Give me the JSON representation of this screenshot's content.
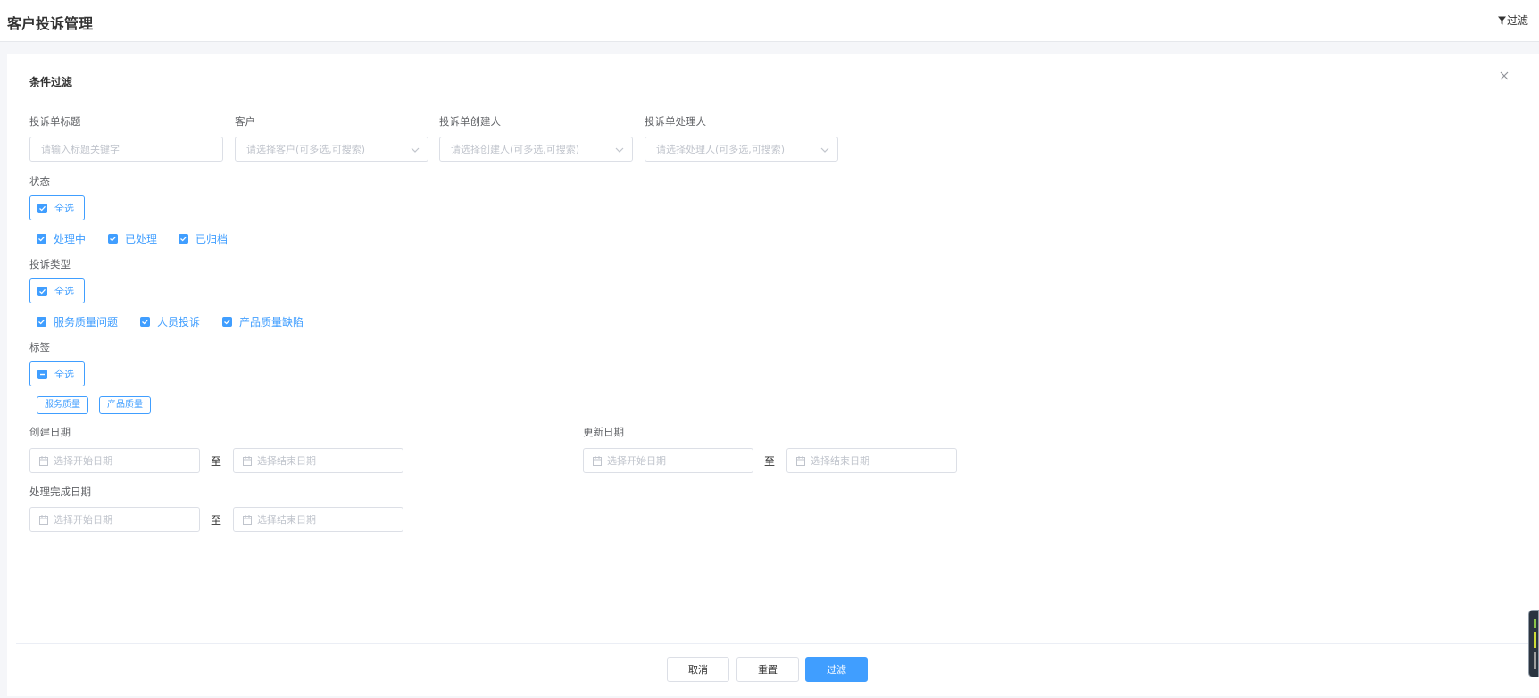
{
  "header": {
    "title": "客户投诉管理",
    "filter_label": "过滤"
  },
  "panel": {
    "title": "条件过滤"
  },
  "fields": {
    "complaint_title": {
      "label": "投诉单标题",
      "placeholder": "请输入标题关键字"
    },
    "customer": {
      "label": "客户",
      "placeholder": "请选择客户(可多选,可搜索)"
    },
    "creator": {
      "label": "投诉单创建人",
      "placeholder": "请选择创建人(可多选,可搜索)"
    },
    "handler": {
      "label": "投诉单处理人",
      "placeholder": "请选择处理人(可多选,可搜索)"
    }
  },
  "status": {
    "label": "状态",
    "select_all": "全选",
    "options": [
      "处理中",
      "已处理",
      "已归档"
    ]
  },
  "complaint_type": {
    "label": "投诉类型",
    "select_all": "全选",
    "options": [
      "服务质量问题",
      "人员投诉",
      "产品质量缺陷"
    ]
  },
  "tags": {
    "label": "标签",
    "select_all": "全选",
    "items": [
      "服务质量",
      "产品质量"
    ]
  },
  "dates": {
    "to": "至",
    "created": {
      "label": "创建日期",
      "start_placeholder": "选择开始日期",
      "end_placeholder": "选择结束日期"
    },
    "updated": {
      "label": "更新日期",
      "start_placeholder": "选择开始日期",
      "end_placeholder": "选择结束日期"
    },
    "completed": {
      "label": "处理完成日期",
      "start_placeholder": "选择开始日期",
      "end_placeholder": "选择结束日期"
    }
  },
  "footer": {
    "cancel": "取消",
    "reset": "重置",
    "filter": "过滤"
  },
  "colors": {
    "primary": "#409eff",
    "border": "#dcdfe6",
    "placeholder": "#c0c4cc"
  }
}
